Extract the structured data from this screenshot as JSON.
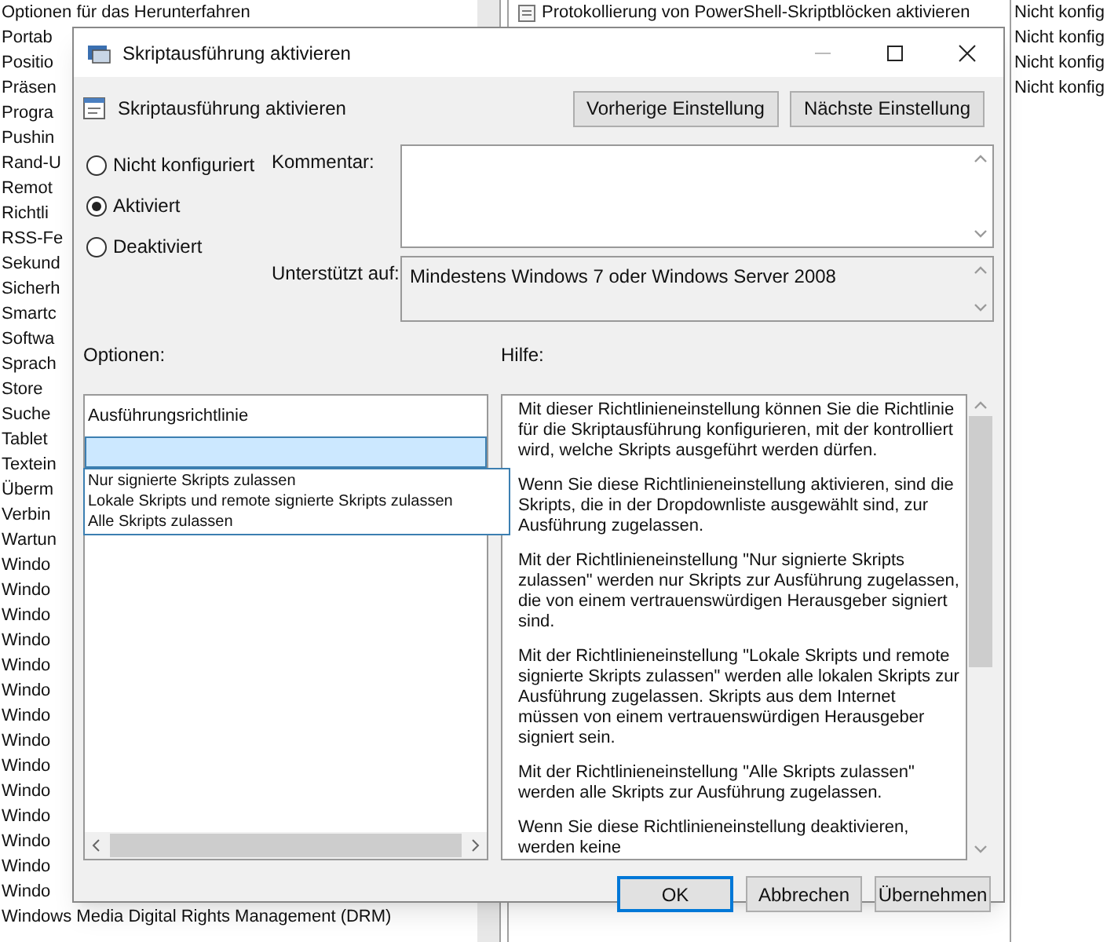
{
  "background": {
    "tree_items": [
      "Optionen für das Herunterfahren",
      "Portab",
      "Positio",
      "Präsen",
      "Progra",
      "Pushin",
      "Rand-U",
      "Remot",
      "Richtli",
      "RSS-Fe",
      "Sekund",
      "Sicherh",
      "Smartc",
      "Softwa",
      "Sprach",
      "Store",
      "Suche",
      "Tablet",
      "Textein",
      "Überm",
      "Verbin",
      "Wartun",
      "Windo",
      "Windo",
      "Windo",
      "Windo",
      "Windo",
      "Windo",
      "Windo",
      "Windo",
      "Windo",
      "Windo",
      "Windo",
      "Windo",
      "Windo",
      "Windo",
      "Windows Media Digital Rights Management (DRM)"
    ],
    "policy_rows": [
      {
        "name": "Protokollierung von PowerShell-Skriptblöcken aktivieren",
        "state": "Nicht konfig"
      },
      {
        "state": "Nicht konfig"
      },
      {
        "state": "Nicht konfig"
      },
      {
        "state": "Nicht konfig"
      }
    ]
  },
  "dialog": {
    "title": "Skriptausführung aktivieren",
    "setting_title": "Skriptausführung aktivieren",
    "nav_buttons": [
      "Vorherige Einstellung",
      "Nächste Einstellung"
    ],
    "radios": [
      {
        "label": "Nicht konfiguriert",
        "selected": false
      },
      {
        "label": "Aktiviert",
        "selected": true
      },
      {
        "label": "Deaktiviert",
        "selected": false
      }
    ],
    "comment_label": "Kommentar:",
    "supported_label": "Unterstützt auf:",
    "supported_value": "Mindestens Windows 7 oder Windows Server 2008",
    "options_label": "Optionen:",
    "help_label": "Hilfe:",
    "options": {
      "label": "Ausführungsrichtlinie",
      "dropdown_items": [
        "Nur signierte Skripts zulassen",
        "Lokale Skripts und remote signierte Skripts zulassen",
        "Alle Skripts zulassen"
      ]
    },
    "help_paragraphs": [
      "Mit dieser Richtlinieneinstellung können Sie die Richtlinie für die Skriptausführung konfigurieren, mit der kontrolliert wird, welche Skripts ausgeführt werden dürfen.",
      "Wenn Sie diese Richtlinieneinstellung aktivieren, sind die Skripts, die in der Dropdownliste ausgewählt sind, zur Ausführung zugelassen.",
      "Mit der Richtlinieneinstellung \"Nur signierte Skripts zulassen\" werden nur Skripts zur Ausführung zugelassen, die von einem vertrauenswürdigen Herausgeber signiert sind.",
      "Mit der Richtlinieneinstellung \"Lokale Skripts und remote signierte Skripts zulassen\" werden alle lokalen Skripts zur Ausführung zugelassen. Skripts aus dem Internet müssen von einem vertrauenswürdigen Herausgeber signiert sein.",
      "Mit der Richtlinieneinstellung \"Alle Skripts zulassen\" werden alle Skripts zur Ausführung zugelassen.",
      "Wenn Sie diese Richtlinieneinstellung deaktivieren, werden keine"
    ],
    "buttons": [
      {
        "label": "OK",
        "default": true
      },
      {
        "label": "Abbrechen",
        "default": false
      },
      {
        "label": "Übernehmen",
        "default": false
      }
    ]
  }
}
